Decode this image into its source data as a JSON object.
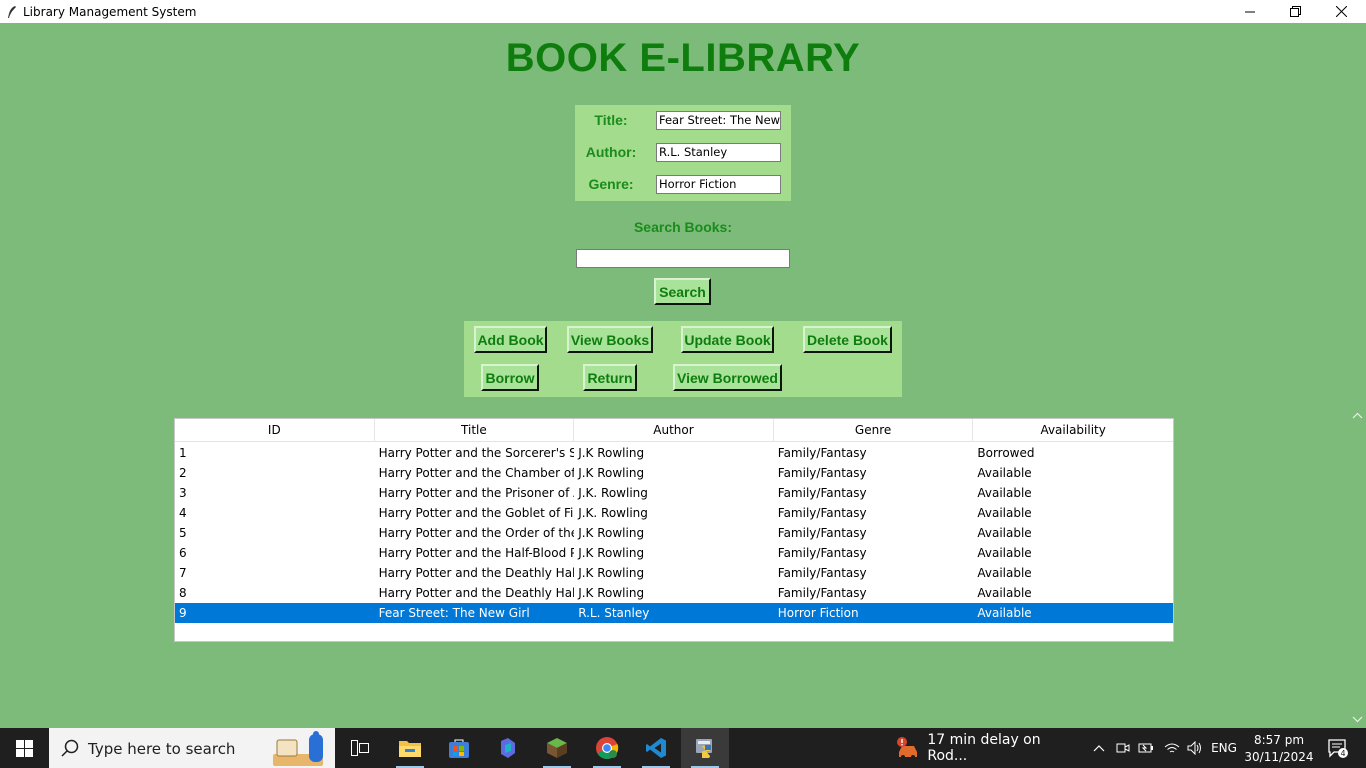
{
  "window": {
    "title": "Library Management System"
  },
  "heading": "BOOK E-LIBRARY",
  "form": {
    "fields": [
      {
        "label": "Title:",
        "value": "Fear Street: The New Gi"
      },
      {
        "label": "Author:",
        "value": "R.L. Stanley"
      },
      {
        "label": "Genre:",
        "value": "Horror Fiction"
      }
    ]
  },
  "search": {
    "label": "Search Books:",
    "value": "",
    "button": "Search"
  },
  "actions": {
    "add": "Add Book",
    "view": "View Books",
    "update": "Update Book",
    "delete": "Delete Book",
    "borrow": "Borrow",
    "return": "Return",
    "view_borrowed": "View Borrowed"
  },
  "table": {
    "columns": [
      "ID",
      "Title",
      "Author",
      "Genre",
      "Availability"
    ],
    "rows": [
      [
        "1",
        "Harry Potter and the Sorcerer's Stone",
        "J.K Rowling",
        "Family/Fantasy",
        "Borrowed"
      ],
      [
        "2",
        "Harry Potter and the Chamber of Sec",
        "J.K Rowling",
        "Family/Fantasy",
        "Available"
      ],
      [
        "3",
        "Harry Potter and the Prisoner of Azka",
        "J.K. Rowling",
        "Family/Fantasy",
        "Available"
      ],
      [
        "4",
        "Harry Potter and the Goblet of Fire",
        "J.K. Rowling",
        "Family/Fantasy",
        "Available"
      ],
      [
        "5",
        "Harry Potter and the Order of the Ph",
        "J.K Rowling",
        "Family/Fantasy",
        "Available"
      ],
      [
        "6",
        "Harry Potter and the Half-Blood Prin",
        "J.K Rowling",
        "Family/Fantasy",
        "Available"
      ],
      [
        "7",
        "Harry Potter and the Deathly Hallows",
        "J.K Rowling",
        "Family/Fantasy",
        "Available"
      ],
      [
        "8",
        "Harry Potter and the Deathly Hallows",
        "J.K Rowling",
        "Family/Fantasy",
        "Available"
      ],
      [
        "9",
        "Fear Street: The New Girl",
        "R.L. Stanley",
        "Horror Fiction",
        "Available"
      ]
    ],
    "selected_row": 8
  },
  "taskbar": {
    "search_placeholder": "Type here to search",
    "notification": "17 min delay on Rod...",
    "language": "ENG",
    "time": "8:57 pm",
    "date": "30/11/2024",
    "notification_count": "4",
    "icons": [
      "start-icon",
      "search-icon",
      "widgets-icon",
      "task-view-icon",
      "file-explorer-icon",
      "microsoft-store-icon",
      "copilot-icon",
      "minecraft-icon",
      "chrome-icon",
      "vscode-icon",
      "python-icon"
    ]
  },
  "colors": {
    "background": "#7dbb7a",
    "frame": "#a4dc8e",
    "heading": "#0e7d0e",
    "label": "#1b8c1b",
    "selection": "#0078d7"
  }
}
